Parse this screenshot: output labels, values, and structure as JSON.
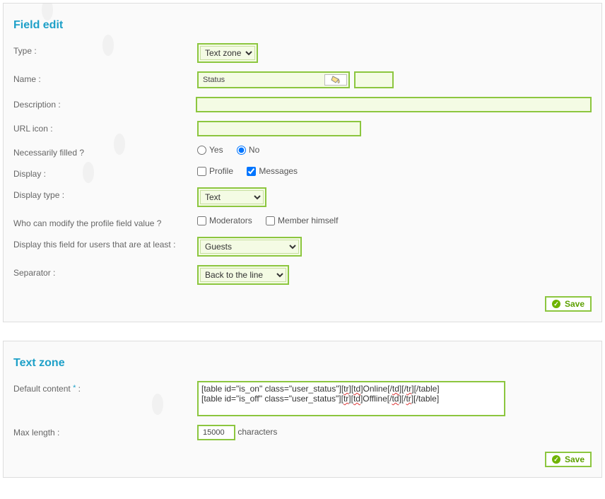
{
  "panel1": {
    "title": "Field edit",
    "labels": {
      "type": "Type :",
      "name": "Name :",
      "description": "Description :",
      "url_icon": "URL icon :",
      "necessarily": "Necessarily filled ?",
      "display": "Display :",
      "display_type": "Display type :",
      "who_modify": "Who can modify the profile field value ?",
      "display_level": "Display this field for users that are at least :",
      "separator": "Separator :"
    },
    "type_value": "Text zone",
    "name_value": "Status",
    "description_value": "",
    "url_icon_value": "",
    "radio_yes": "Yes",
    "radio_no": "No",
    "necessarily_value": "no",
    "chk_profile": "Profile",
    "chk_messages": "Messages",
    "display_profile": false,
    "display_messages": true,
    "display_type_value": "Text",
    "chk_moderators": "Moderators",
    "chk_member": "Member himself",
    "mod_moderators": false,
    "mod_member": false,
    "display_level_value": "Guests",
    "separator_value": "Back to the line",
    "save": "Save"
  },
  "panel2": {
    "title": "Text zone",
    "labels": {
      "default_content": "Default content",
      "max_length": "Max length :",
      "characters": "characters"
    },
    "default_content_value": "[table id=\"is_on\" class=\"user_status\"][tr][td]Online[/td][/tr][/table]\n[table id=\"is_off\" class=\"user_status\"][tr][td]Offline[/td][/tr][/table]",
    "max_length_value": "15000",
    "save": "Save"
  }
}
